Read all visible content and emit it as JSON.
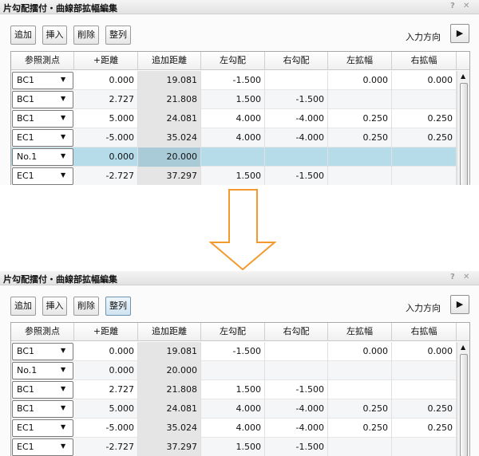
{
  "window_title": "片勾配擂付・曲線部拡幅編集",
  "icons": {
    "help": "?",
    "close": "✕",
    "play": "▶",
    "dropdown": "▼",
    "scroll_up": "▲"
  },
  "toolbar": {
    "add": "追加",
    "insert": "挿入",
    "delete": "削除",
    "sort": "整列",
    "direction_label": "入力方向"
  },
  "columns": [
    "参照測点",
    "+距離",
    "追加距離",
    "左勾配",
    "右勾配",
    "左拡幅",
    "右拡幅"
  ],
  "before": {
    "rows": [
      {
        "ref": "BC1",
        "dist": "0.000",
        "add": "19.081",
        "lslope": "-1.500",
        "rslope": "",
        "lwiden": "0.000",
        "rwiden": "0.000"
      },
      {
        "ref": "BC1",
        "dist": "2.727",
        "add": "21.808",
        "lslope": "1.500",
        "rslope": "-1.500",
        "lwiden": "",
        "rwiden": ""
      },
      {
        "ref": "BC1",
        "dist": "5.000",
        "add": "24.081",
        "lslope": "4.000",
        "rslope": "-4.000",
        "lwiden": "0.250",
        "rwiden": "0.250"
      },
      {
        "ref": "EC1",
        "dist": "-5.000",
        "add": "35.024",
        "lslope": "4.000",
        "rslope": "-4.000",
        "lwiden": "0.250",
        "rwiden": "0.250"
      },
      {
        "ref": "No.1",
        "dist": "0.000",
        "add": "20.000",
        "lslope": "",
        "rslope": "",
        "lwiden": "",
        "rwiden": ""
      },
      {
        "ref": "EC1",
        "dist": "-2.727",
        "add": "37.297",
        "lslope": "1.500",
        "rslope": "-1.500",
        "lwiden": "",
        "rwiden": ""
      }
    ]
  },
  "after": {
    "rows": [
      {
        "ref": "BC1",
        "dist": "0.000",
        "add": "19.081",
        "lslope": "-1.500",
        "rslope": "",
        "lwiden": "0.000",
        "rwiden": "0.000"
      },
      {
        "ref": "No.1",
        "dist": "0.000",
        "add": "20.000",
        "lslope": "",
        "rslope": "",
        "lwiden": "",
        "rwiden": ""
      },
      {
        "ref": "BC1",
        "dist": "2.727",
        "add": "21.808",
        "lslope": "1.500",
        "rslope": "-1.500",
        "lwiden": "",
        "rwiden": ""
      },
      {
        "ref": "BC1",
        "dist": "5.000",
        "add": "24.081",
        "lslope": "4.000",
        "rslope": "-4.000",
        "lwiden": "0.250",
        "rwiden": "0.250"
      },
      {
        "ref": "EC1",
        "dist": "-5.000",
        "add": "35.024",
        "lslope": "4.000",
        "rslope": "-4.000",
        "lwiden": "0.250",
        "rwiden": "0.250"
      },
      {
        "ref": "EC1",
        "dist": "-2.727",
        "add": "37.297",
        "lslope": "1.500",
        "rslope": "-1.500",
        "lwiden": "",
        "rwiden": ""
      }
    ]
  },
  "colors": {
    "accent_arrow": "#f29a2e",
    "selected_row": "#b7dce9",
    "added_distance_column": "#e5e5e5"
  }
}
